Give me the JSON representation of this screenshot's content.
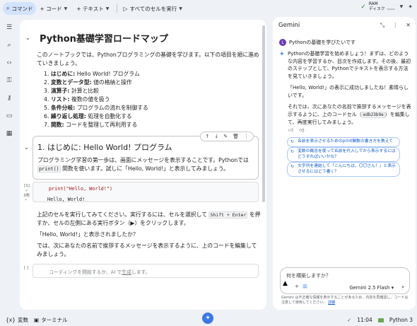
{
  "toolbar": {
    "command_label": "コマンド",
    "code_label": "+ コード",
    "text_label": "+ テキスト",
    "run_all_label": "すべてのセルを実行",
    "ram_label": "RAM",
    "disk_label": "ディスク"
  },
  "notebook": {
    "title": "Python基礎学習ロードマップ",
    "intro": "このノートブックでは、Pythonプログラミングの基礎を学びます。以下の項目を順に進めていきましょう。",
    "items": [
      {
        "num": "1.",
        "bold": "はじめに:",
        "text": " Hello World! プログラム"
      },
      {
        "num": "2.",
        "bold": "変数とデータ型:",
        "text": " 値の格納と操作"
      },
      {
        "num": "3.",
        "bold": "演算子:",
        "text": " 計算と比較"
      },
      {
        "num": "4.",
        "bold": "リスト:",
        "text": " 複数の値を扱う"
      },
      {
        "num": "5.",
        "bold": "条件分岐:",
        "text": " プログラムの流れを制御する"
      },
      {
        "num": "6.",
        "bold": "繰り返し処理:",
        "text": " 処理を自動化する"
      },
      {
        "num": "7.",
        "bold": "関数:",
        "text": " コードを整理して再利用する"
      }
    ],
    "section_title": "1. はじめに: Hello World! プログラム",
    "section_body_1": "プログラミング学習の第一歩は、画面にメッセージを表示することです。Pythonでは",
    "section_code": "print()",
    "section_body_2": " 関数を使います。試しに「Hello, World!」と表示してみましょう。",
    "exec_count": "[1]",
    "exec_time": "0秒",
    "code": "print(\"Hello, World!\")",
    "output": "Hello, World!",
    "after_1": "上記のセルを実行してみてください。実行するには、セルを選択して",
    "after_key": "Shift + Enter",
    "after_2": "を押すか、セルの左側にある実行ボタン（▶）をクリックします。",
    "after_q": "「Hello, World!」と表示されましたか？",
    "after_next": "では、次にあなたの名前で挨拶するメッセージを表示するように、上のコードを編集してみましょう。",
    "empty_exec": "[ ]",
    "empty_placeholder_1": "コーディングを開始するか、AI で",
    "empty_placeholder_link": "生成",
    "empty_placeholder_2": "します。"
  },
  "gemini": {
    "title": "Gemini",
    "user_initial": "L",
    "user_message": "Pythonの基礎を学びたいです",
    "reply_1": "Pythonの基礎学習を始めましょう！まずは、どのような内容を学習するか、目次を作成します。その後、最初のステップとして、Pythonでテキストを表示する方法を見ていきましょう。",
    "reply_2": "「Hello, World!」の表示に成功しましたね！素晴らしいです。",
    "reply_3a": "それでは、次にあなたの名前で挨拶するメッセージを表示するように、上のコードセル（",
    "reply_code": "edb23b9e",
    "reply_3b": "）を編集して、再度実行してみましょう。",
    "suggestions": [
      "名前を表示させるためのprint関数の書き方を教えて",
      "変数の概念を使って名前を代入してから表示するにはどうすればいいかな？",
      "文字列を連結して「こんにちは、〇〇さん！」と表示させるにはどう書く？"
    ],
    "prompt_placeholder": "何を構築しますか？",
    "model": "Gemini 2.5 Flash",
    "disclaimer_1": "Gemini は不正確な情報を表示することがあるため、内容を再確認し、コードは注意して使用してください。",
    "disclaimer_link": "詳細"
  },
  "bottom": {
    "variables": "変数",
    "terminal": "ターミナル",
    "time": "11:04",
    "runtime": "Python 3"
  }
}
